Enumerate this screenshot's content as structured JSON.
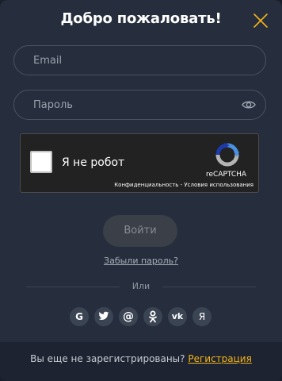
{
  "modal": {
    "title": "Добро пожаловать!"
  },
  "form": {
    "email_placeholder": "Email",
    "password_placeholder": "Пароль",
    "login_label": "Войти",
    "forgot_label": "Забыли пароль?"
  },
  "recaptcha": {
    "label": "Я не робот",
    "brand": "reCAPTCHA",
    "privacy": "Конфиденциальность",
    "separator": " - ",
    "terms": "Условия использования"
  },
  "divider": {
    "label": "Или"
  },
  "socials": [
    {
      "icon": "google-icon",
      "glyph": "G"
    },
    {
      "icon": "twitter-icon",
      "glyph": ""
    },
    {
      "icon": "at-sign-icon",
      "glyph": "@"
    },
    {
      "icon": "odnoklassniki-icon",
      "glyph": ""
    },
    {
      "icon": "vk-icon",
      "glyph": "vk"
    },
    {
      "icon": "yandex-icon",
      "glyph": "Я"
    }
  ],
  "footer": {
    "question": "Вы еще не зарегистрированы?",
    "register_label": "Регистрация"
  },
  "colors": {
    "accent": "#f4b41a",
    "background": "#262e3d",
    "footer": "#1d2330"
  }
}
